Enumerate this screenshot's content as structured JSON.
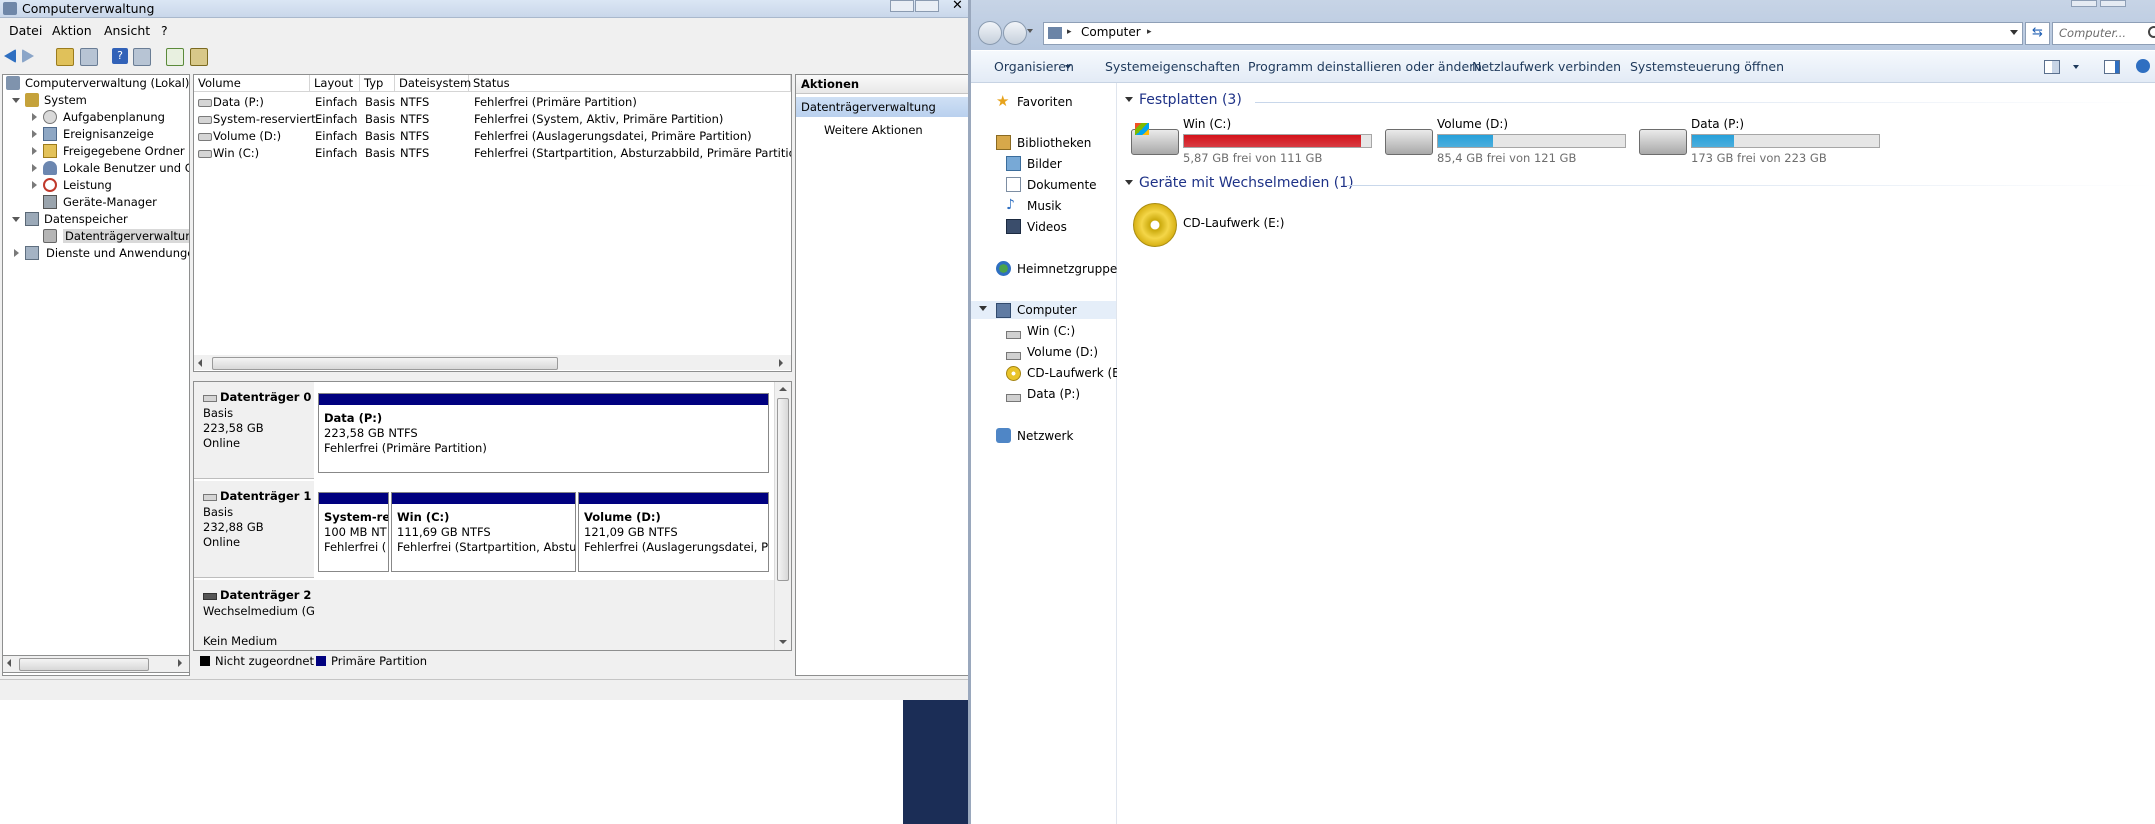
{
  "cm": {
    "title": "Computerverwaltung",
    "menu": [
      "Datei",
      "Aktion",
      "Ansicht",
      "?"
    ],
    "tree": [
      {
        "label": "Computerverwaltung (Lokal)",
        "icon": "computer-management-icon"
      },
      {
        "label": "System",
        "icon": "system-tools-icon"
      },
      {
        "label": "Aufgabenplanung",
        "icon": "task-scheduler-icon"
      },
      {
        "label": "Ereignisanzeige",
        "icon": "event-viewer-icon"
      },
      {
        "label": "Freigegebene Ordner",
        "icon": "shared-folder-icon"
      },
      {
        "label": "Lokale Benutzer und Gr",
        "icon": "users-icon"
      },
      {
        "label": "Leistung",
        "icon": "performance-icon"
      },
      {
        "label": "Geräte-Manager",
        "icon": "device-manager-icon"
      },
      {
        "label": "Datenspeicher",
        "icon": "storage-icon"
      },
      {
        "label": "Datenträgerverwaltung",
        "icon": "disk-management-icon"
      },
      {
        "label": "Dienste und Anwendungen",
        "icon": "services-icon"
      }
    ],
    "columns": [
      "Volume",
      "Layout",
      "Typ",
      "Dateisystem",
      "Status"
    ],
    "volumes": [
      {
        "volume": "Data (P:)",
        "layout": "Einfach",
        "typ": "Basis",
        "fs": "NTFS",
        "status": "Fehlerfrei (Primäre Partition)"
      },
      {
        "volume": "System-reserviert",
        "layout": "Einfach",
        "typ": "Basis",
        "fs": "NTFS",
        "status": "Fehlerfrei (System, Aktiv, Primäre Partition)"
      },
      {
        "volume": "Volume (D:)",
        "layout": "Einfach",
        "typ": "Basis",
        "fs": "NTFS",
        "status": "Fehlerfrei (Auslagerungsdatei, Primäre Partition)"
      },
      {
        "volume": "Win (C:)",
        "layout": "Einfach",
        "typ": "Basis",
        "fs": "NTFS",
        "status": "Fehlerfrei (Startpartition, Absturzabbild, Primäre Partition)"
      }
    ],
    "disks": [
      {
        "name": "Datenträger 0",
        "line1": "Basis",
        "line2": "223,58 GB",
        "line3": "Online",
        "partitions": [
          {
            "name": "Data  (P:)",
            "size": "223,58 GB NTFS",
            "status": "Fehlerfrei (Primäre Partition)"
          }
        ]
      },
      {
        "name": "Datenträger 1",
        "line1": "Basis",
        "line2": "232,88 GB",
        "line3": "Online",
        "partitions": [
          {
            "name": "System-re",
            "size": "100 MB NT",
            "status": "Fehlerfrei ("
          },
          {
            "name": "Win  (C:)",
            "size": "111,69 GB NTFS",
            "status": "Fehlerfrei (Startpartition, Absturz"
          },
          {
            "name": "Volume  (D:)",
            "size": "121,09 GB NTFS",
            "status": "Fehlerfrei (Auslagerungsdatei, Pri"
          }
        ]
      },
      {
        "name": "Datenträger 2",
        "line1": "Wechselmedium (G:",
        "line2": "",
        "line3": "Kein Medium",
        "partitions": []
      }
    ],
    "legend": [
      {
        "label": "Nicht zugeordnet",
        "color": "#000000"
      },
      {
        "label": "Primäre Partition",
        "color": "#00007f"
      }
    ],
    "actions": {
      "header": "Aktionen",
      "selected": "Datenträgerverwaltung",
      "more": "Weitere Aktionen"
    }
  },
  "ex": {
    "breadcrumb": "Computer",
    "search_placeholder": "Computer...",
    "commands": [
      "Organisieren",
      "Systemeigenschaften",
      "Programm deinstallieren oder ändern",
      "Netzlaufwerk verbinden",
      "Systemsteuerung öffnen"
    ],
    "nav": {
      "favorites": "Favoriten",
      "libraries": "Bibliotheken",
      "library_items": [
        "Bilder",
        "Dokumente",
        "Musik",
        "Videos"
      ],
      "homegroup": "Heimnetzgruppe",
      "computer": "Computer",
      "computer_items": [
        "Win (C:)",
        "Volume (D:)",
        "CD-Laufwerk (E:)",
        "Data (P:)"
      ],
      "network": "Netzwerk"
    },
    "groups": {
      "hdd": "Festplatten (3)",
      "removable": "Geräte mit Wechselmedien (1)"
    },
    "drives": [
      {
        "name": "Win (C:)",
        "free": "5,87 GB frei von 111 GB",
        "used_fraction": 0.947,
        "color": "#d4121a"
      },
      {
        "name": "Volume (D:)",
        "free": "85,4 GB frei von 121 GB",
        "used_fraction": 0.294,
        "color": "#26a0da"
      },
      {
        "name": "Data (P:)",
        "free": "173 GB frei von 223 GB",
        "used_fraction": 0.224,
        "color": "#26a0da"
      }
    ],
    "cd": {
      "name": "CD-Laufwerk (E:)"
    }
  }
}
